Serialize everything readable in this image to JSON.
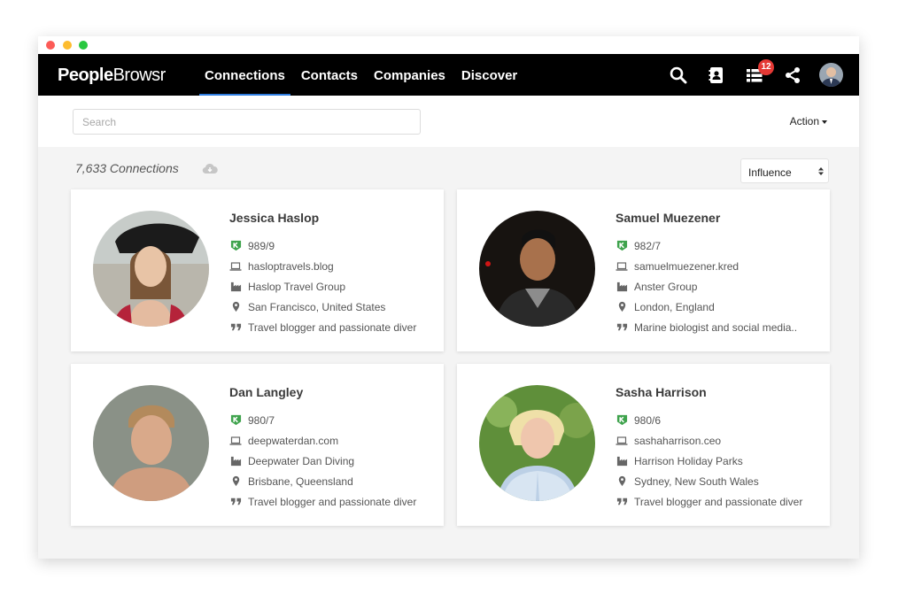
{
  "app": {
    "logo_bold": "People",
    "logo_light": "Browsr"
  },
  "nav": {
    "tabs": [
      {
        "label": "Connections",
        "active": true
      },
      {
        "label": "Contacts"
      },
      {
        "label": "Companies"
      },
      {
        "label": "Discover"
      }
    ],
    "notification_count": "12"
  },
  "toolbar": {
    "search_placeholder": "Search",
    "action_label": "Action"
  },
  "summary": {
    "count_text": "7,633 Connections"
  },
  "sort": {
    "selected": "Influence"
  },
  "colors": {
    "accent": "#2f7de1",
    "badge": "#e53935",
    "navbar": "#000000",
    "kred": "#3fa34d"
  },
  "people": [
    {
      "name": "Jessica Haslop",
      "score": "989/9",
      "website": "hasloptravels.blog",
      "company": "Haslop Travel Group",
      "location": "San Francisco, United States",
      "bio": "Travel blogger and passionate diver"
    },
    {
      "name": "Samuel Muezener",
      "score": "982/7",
      "website": "samuelmuezener.kred",
      "company": "Anster Group",
      "location": "London, England",
      "bio": "Marine biologist and social media.."
    },
    {
      "name": "Dan Langley",
      "score": "980/7",
      "website": "deepwaterdan.com",
      "company": "Deepwater Dan Diving",
      "location": "Brisbane, Queensland",
      "bio": "Travel blogger and passionate diver"
    },
    {
      "name": "Sasha Harrison",
      "score": "980/6",
      "website": "sashaharrison.ceo",
      "company": "Harrison Holiday Parks",
      "location": "Sydney, New South Wales",
      "bio": "Travel blogger and passionate diver"
    }
  ]
}
